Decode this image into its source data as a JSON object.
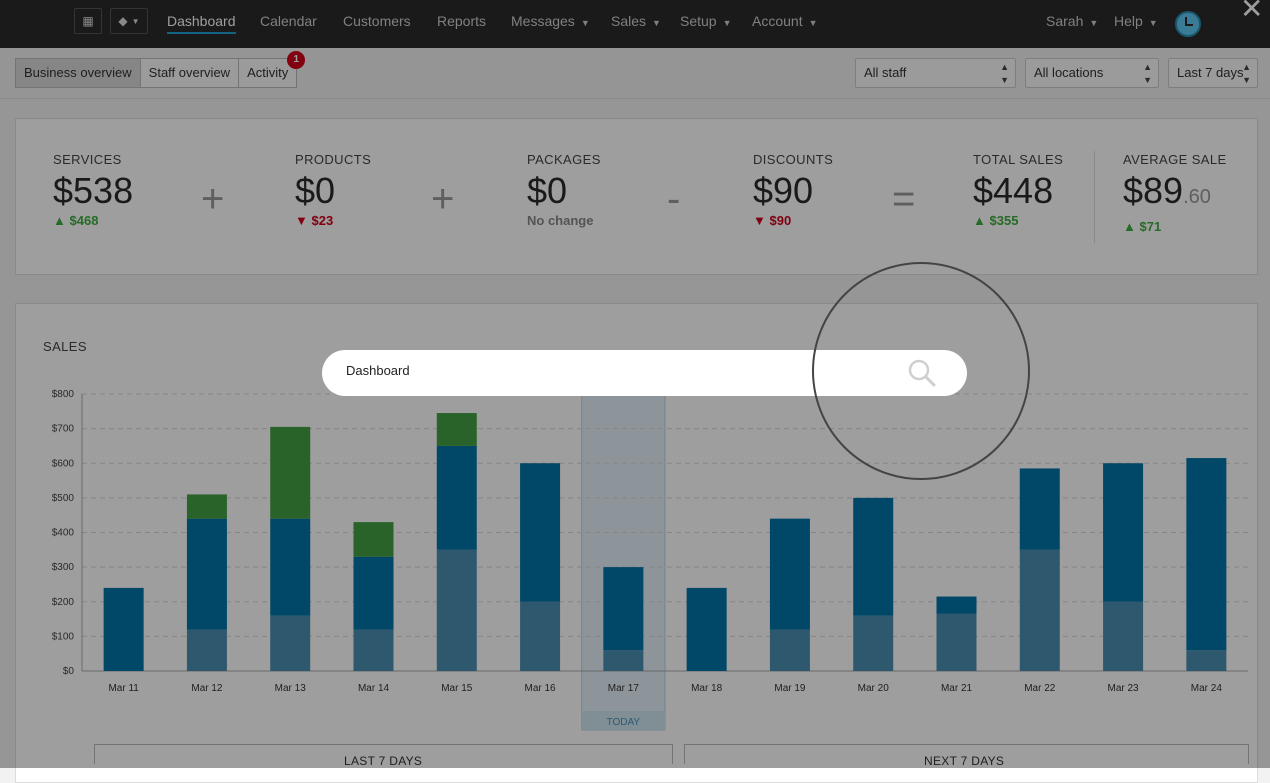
{
  "topbar": {
    "nav": [
      "Dashboard",
      "Calendar",
      "Customers",
      "Reports",
      "Messages",
      "Sales",
      "Setup",
      "Account"
    ],
    "user": "Sarah",
    "help": "Help"
  },
  "subbar": {
    "tabs": [
      "Business overview",
      "Staff overview",
      "Activity"
    ],
    "activity_badge": "1",
    "staff_select": "All staff",
    "location_select": "All locations",
    "range_select": "Last 7 days"
  },
  "stats": {
    "services": {
      "label": "SERVICES",
      "value": "$538",
      "change": "$468",
      "dir": "up"
    },
    "products": {
      "label": "PRODUCTS",
      "value": "$0",
      "change": "$23",
      "dir": "down"
    },
    "packages": {
      "label": "PACKAGES",
      "value": "$0",
      "change": "No change",
      "dir": "none"
    },
    "discounts": {
      "label": "DISCOUNTS",
      "value": "$90",
      "change": "$90",
      "dir": "down"
    },
    "total": {
      "label": "TOTAL SALES",
      "value": "$448",
      "change": "$355",
      "dir": "up"
    },
    "average": {
      "label": "AVERAGE SALE",
      "value": "$89",
      "cents": ".60",
      "change": "$71",
      "dir": "up"
    },
    "ops": [
      "+",
      "+",
      "-",
      "="
    ]
  },
  "chart_title": "SALES",
  "chart_data": {
    "type": "bar",
    "stacked": true,
    "categories": [
      "Mar 11",
      "Mar 12",
      "Mar 13",
      "Mar 14",
      "Mar 15",
      "Mar 16",
      "Mar 17",
      "Mar 18",
      "Mar 19",
      "Mar 20",
      "Mar 21",
      "Mar 22",
      "Mar 23",
      "Mar 24"
    ],
    "series": [
      {
        "values": [
          0,
          120,
          160,
          120,
          350,
          200,
          60,
          0,
          120,
          160,
          165,
          350,
          200,
          60
        ],
        "color": "#4b8fb0"
      },
      {
        "values": [
          240,
          320,
          280,
          210,
          300,
          400,
          240,
          240,
          320,
          340,
          50,
          235,
          400,
          555
        ],
        "color": "#0073a8"
      },
      {
        "values": [
          0,
          70,
          265,
          100,
          95,
          0,
          0,
          0,
          0,
          0,
          0,
          0,
          0,
          0
        ],
        "color": "#45a045"
      }
    ],
    "ylim": [
      0,
      800
    ],
    "yticks": [
      "$0",
      "$100",
      "$200",
      "$300",
      "$400",
      "$500",
      "$600",
      "$700",
      "$800"
    ],
    "today_index": 6,
    "today_label": "TODAY",
    "grid": true
  },
  "periods": {
    "last": "LAST 7 DAYS",
    "next": "NEXT 7 DAYS"
  },
  "search": {
    "value": "Dashboard"
  },
  "colors": {
    "accent": "#1fa0d6",
    "up": "#3cae3c",
    "down": "#d0021b"
  }
}
